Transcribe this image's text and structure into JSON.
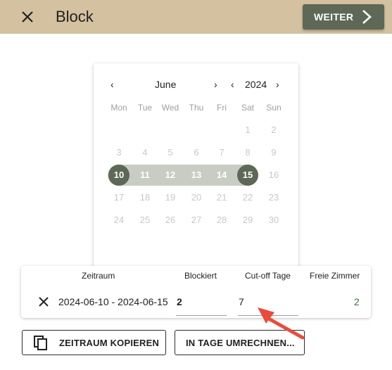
{
  "topbar": {
    "title": "Block",
    "close_icon": "close-icon",
    "weiter_label": "WEITER",
    "weiter_icon": "chevron-right-icon",
    "accent_color": "#d3c19f",
    "button_color": "#5d6856"
  },
  "calendar": {
    "month": "June",
    "year": "2024",
    "prev_month": "‹",
    "next_month": "›",
    "prev_year": "‹",
    "next_year": "›",
    "weekdays": [
      "Mon",
      "Tue",
      "Wed",
      "Thu",
      "Fri",
      "Sat",
      "Sun"
    ],
    "weeks": [
      [
        "",
        "",
        "",
        "",
        "",
        "1",
        "2"
      ],
      [
        "3",
        "4",
        "5",
        "6",
        "7",
        "8",
        "9"
      ],
      [
        "10",
        "11",
        "12",
        "13",
        "14",
        "15",
        "16"
      ],
      [
        "17",
        "18",
        "19",
        "20",
        "21",
        "22",
        "23"
      ],
      [
        "24",
        "25",
        "26",
        "27",
        "28",
        "29",
        "30"
      ]
    ],
    "range_start": "10",
    "range_end": "15"
  },
  "table": {
    "headers": {
      "zeitraum": "Zeitraum",
      "blockiert": "Blockiert",
      "cutoff": "Cut-off Tage",
      "freie": "Freie Zimmer"
    },
    "row": {
      "zeitraum": "2024-06-10 - 2024-06-15",
      "blockiert": "2",
      "cutoff": "7",
      "freie": "2"
    },
    "remove_icon": "close-icon"
  },
  "actions": {
    "copy_label": "ZEITRAUM KOPIEREN",
    "copy_icon": "copy-icon",
    "convert_label": "IN TAGE UMRECHNEN..."
  },
  "annotation": {
    "arrow_color": "#e94c3c"
  }
}
